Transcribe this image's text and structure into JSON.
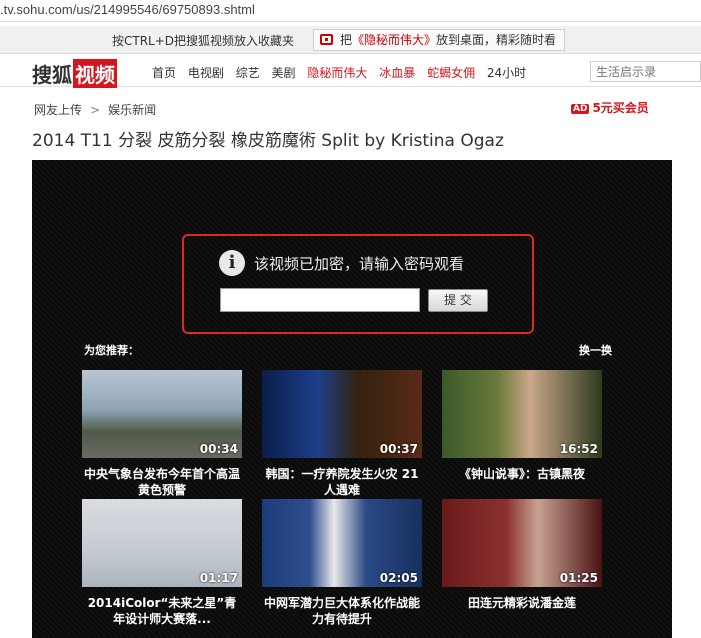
{
  "browser": {
    "url": ".tv.sohu.com/us/214995546/69750893.shtml"
  },
  "tipbar": {
    "left": "按CTRL+D把搜狐视频放入收藏夹",
    "right_prefix": "把",
    "right_highlight": "《隐秘而伟大》",
    "right_suffix": "放到桌面，精彩随时看"
  },
  "nav": {
    "logo_text": "搜狐",
    "logo_box": "视频",
    "links": [
      {
        "label": "首页",
        "red": false
      },
      {
        "label": "电视剧",
        "red": false
      },
      {
        "label": "综艺",
        "red": false
      },
      {
        "label": "美剧",
        "red": false
      },
      {
        "label": "隐秘而伟大",
        "red": true
      },
      {
        "label": "冰血暴",
        "red": true
      },
      {
        "label": "蛇蝎女佣",
        "red": true
      },
      {
        "label": "24小时",
        "red": false
      }
    ],
    "search_placeholder": "生活启示录"
  },
  "breadcrumb": {
    "a": "网友上传",
    "sep": ">",
    "b": "娱乐新闻"
  },
  "vip": {
    "ad": "AD",
    "label": "5元买会员"
  },
  "title": "2014 T11 分裂 皮筋分裂 橡皮筋魔術 Split by Kristina Ogaz",
  "player": {
    "message": "该视频已加密，请输入密码观看",
    "password_value": "",
    "submit": "提 交",
    "rec_title": "为您推荐：",
    "rec_swap": "换一换",
    "cards": [
      {
        "duration": "00:34",
        "caption": "中央气象台发布今年首个高温黄色预警"
      },
      {
        "duration": "00:37",
        "caption": "韩国：一疗养院发生火灾 21人遇难"
      },
      {
        "duration": "16:52",
        "caption": "《钟山说事》：古镇黑夜"
      },
      {
        "duration": "01:17",
        "caption": "2014iColor“未来之星”青年设计师大赛落..."
      },
      {
        "duration": "02:05",
        "caption": "中网军潜力巨大体系化作战能力有待提升"
      },
      {
        "duration": "01:25",
        "caption": "田连元精彩说潘金莲"
      }
    ]
  }
}
